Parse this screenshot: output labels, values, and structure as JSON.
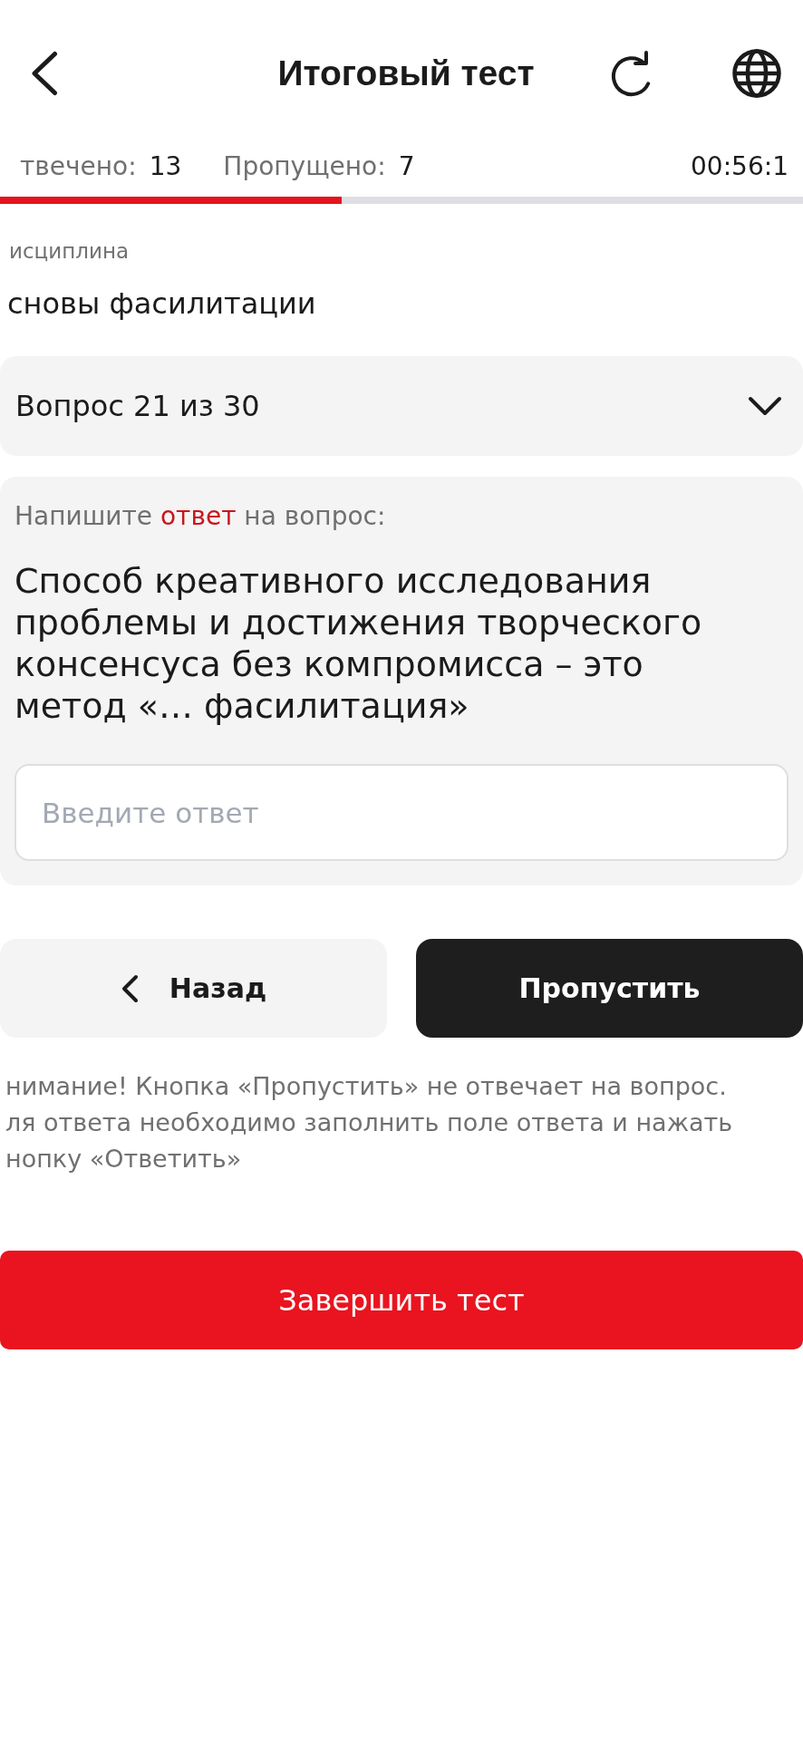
{
  "header": {
    "title": "Итоговый тест"
  },
  "stats": {
    "answered_label": "твечено:",
    "answered_value": "13",
    "skipped_label": "Пропущено:",
    "skipped_value": "7",
    "timer": "00:56:1"
  },
  "progress": {
    "level": 0.425
  },
  "discipline": {
    "label": "исциплина",
    "value": "сновы фасилитации"
  },
  "question_selector": {
    "label": "Вопрос 21 из 30",
    "expanded": false
  },
  "question_card": {
    "instruction": [
      {
        "text": "Напишите ",
        "highlight": false
      },
      {
        "text": "ответ",
        "highlight": true
      },
      {
        "text": " на вопрос:",
        "highlight": false
      }
    ],
    "question": "Способ креативного исследования проблемы и достижения творческого консенсуса без компромисса – это метод «… фасилитация»",
    "answer_field": {
      "placeholder": "Введите ответ"
    }
  },
  "buttons": [
    {
      "kind": "secondary",
      "label": "Назад"
    },
    {
      "kind": "primary",
      "label": "Пропустить"
    }
  ],
  "warning": {
    "lines": [
      "нимание! Кнопка «Пропустить» не отвечает на вопрос.",
      "ля ответа необходимо заполнить поле ответа и нажать",
      "нопку «Ответить»"
    ]
  },
  "finish_button": {
    "label": "Завершить тест"
  }
}
